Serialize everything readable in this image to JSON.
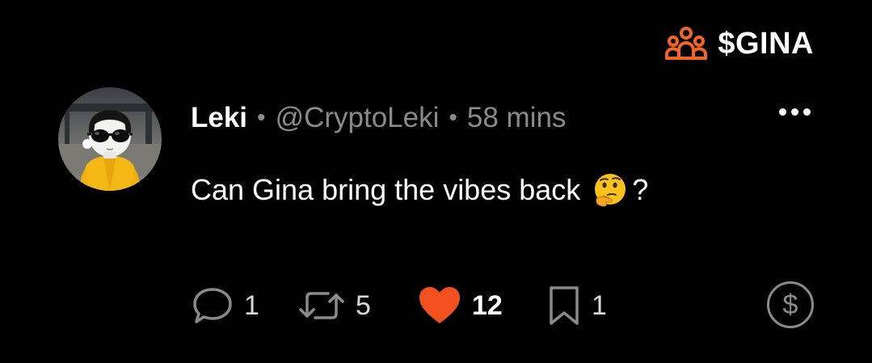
{
  "community": {
    "icon": "community-group-icon",
    "name": "$GINA",
    "accent_color": "#f26522"
  },
  "post": {
    "author": {
      "avatar": "avatar",
      "name": "Leki",
      "handle": "@CryptoLeki"
    },
    "separator": "•",
    "timestamp": "58 mins",
    "more_icon": "more-options-icon",
    "text": "Can Gina bring the vibes back",
    "emoji": "thinking-face-emoji",
    "text_suffix": "?"
  },
  "actions": {
    "reply": {
      "icon": "reply-icon",
      "count": "1"
    },
    "repost": {
      "icon": "repost-icon",
      "count": "5"
    },
    "like": {
      "icon": "heart-icon",
      "count": "12",
      "color": "#f2501e",
      "active": true
    },
    "bookmark": {
      "icon": "bookmark-icon",
      "count": "1"
    },
    "tip": {
      "icon": "dollar-tip-icon",
      "label": "$"
    }
  },
  "colors": {
    "background": "#000000",
    "muted_text": "#8a8a8a",
    "accent": "#f26522"
  }
}
